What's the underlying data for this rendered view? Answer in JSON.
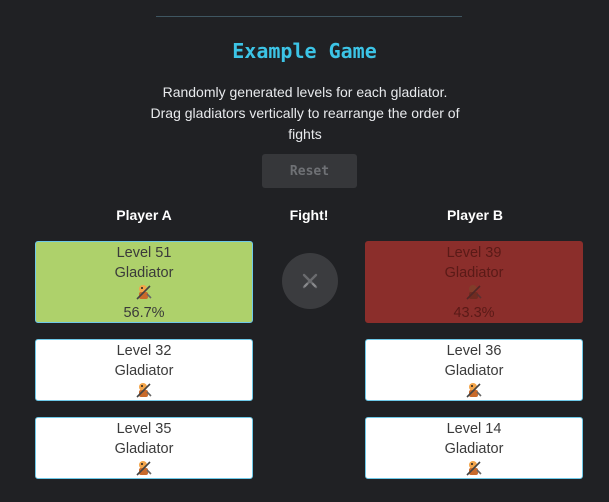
{
  "header": {
    "title": "Example Game",
    "description": "Randomly generated levels for each gladiator. Drag gladiators vertically to rearrange the order of fights",
    "reset_label": "Reset"
  },
  "columns": {
    "player_a": "Player A",
    "fight": "Fight!",
    "player_b": "Player B"
  },
  "player_a": [
    {
      "level": "Level 51",
      "name": "Gladiator",
      "icon": "gladiator-icon",
      "percent": "56.7%"
    },
    {
      "level": "Level 32",
      "name": "Gladiator",
      "icon": "gladiator-icon"
    },
    {
      "level": "Level 35",
      "name": "Gladiator",
      "icon": "gladiator-icon"
    }
  ],
  "player_b": [
    {
      "level": "Level 39",
      "name": "Gladiator",
      "icon": "gladiator-icon",
      "percent": "43.3%"
    },
    {
      "level": "Level 36",
      "name": "Gladiator",
      "icon": "gladiator-icon"
    },
    {
      "level": "Level 14",
      "name": "Gladiator",
      "icon": "gladiator-icon"
    }
  ],
  "fight_button": {
    "icon": "crossed-swords-icon"
  },
  "colors": {
    "background": "#202124",
    "title": "#3cc4e6",
    "winner": "#aed16b",
    "loser": "#8b2e2b",
    "card": "#ffffff",
    "card_border": "#6ec9e8"
  }
}
